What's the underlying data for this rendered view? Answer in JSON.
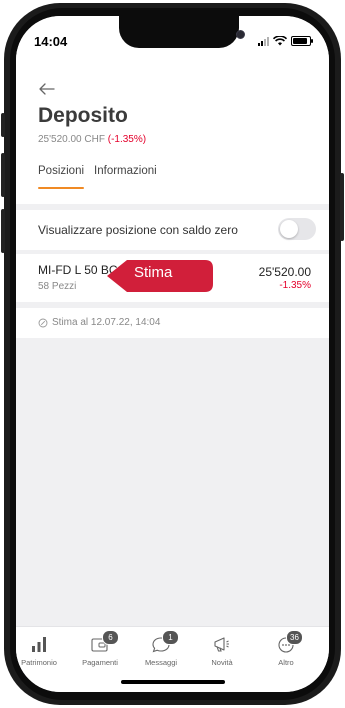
{
  "status_bar": {
    "time": "14:04"
  },
  "header": {
    "title": "Deposito",
    "subtitle_amount": "25'520.00 CHF ",
    "subtitle_change": "(-1.35%)",
    "tabs": [
      {
        "label": "Posizioni",
        "active": true
      },
      {
        "label": "Informazioni",
        "active": false
      }
    ]
  },
  "zero_balance_toggle": {
    "label": "Visualizzare posizione con saldo zero",
    "on": false
  },
  "position": {
    "name": "MI-FD L 50 BC",
    "quantity": "58 Pezzi",
    "value": "25'520.00",
    "change": "-1.35%"
  },
  "callout": {
    "label": "Stima"
  },
  "estimate": {
    "text": "Stima al 12.07.22, 14:04"
  },
  "tabbar": {
    "items": [
      {
        "label": "Patrimonio",
        "icon": "bar-chart-icon",
        "badge": ""
      },
      {
        "label": "Pagamenti",
        "icon": "payments-icon",
        "badge": "6"
      },
      {
        "label": "Messaggi",
        "icon": "chat-bubble-icon",
        "badge": "1"
      },
      {
        "label": "Novità",
        "icon": "megaphone-icon",
        "badge": ""
      },
      {
        "label": "Altro",
        "icon": "more-icon",
        "badge": "36"
      }
    ]
  },
  "colors": {
    "accent_red": "#e4002b",
    "callout_red": "#d11f3a",
    "tab_underline": "#f08a24"
  }
}
